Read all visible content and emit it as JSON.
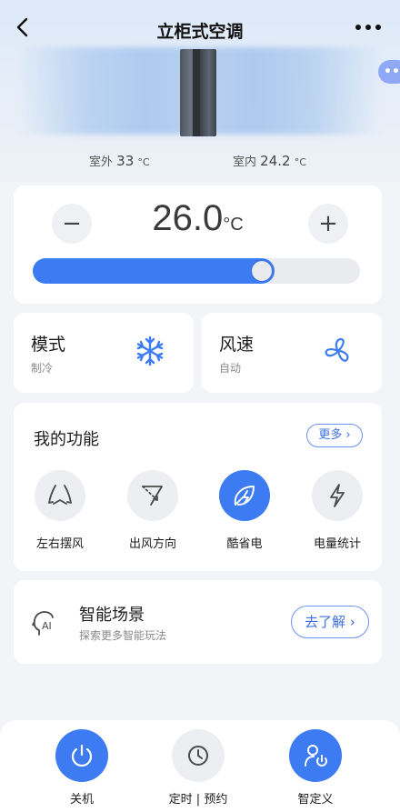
{
  "header": {
    "title": "立柜式空调",
    "back_icon": "chevron-left-icon",
    "more_icon": "more-dots-icon",
    "side_bubble_text": "••"
  },
  "ambient": {
    "outdoor_label": "室外",
    "outdoor_value": "33",
    "outdoor_unit": "°C",
    "indoor_label": "室内",
    "indoor_value": "24.2",
    "indoor_unit": "°C"
  },
  "temperature": {
    "minus_label": "−",
    "plus_label": "+",
    "value": "26.0",
    "unit": "°C",
    "slider_fraction": 0.74
  },
  "mode": {
    "title": "模式",
    "value": "制冷",
    "icon": "snowflake-icon"
  },
  "wind": {
    "title": "风速",
    "value": "自动",
    "icon": "fan-icon"
  },
  "functions": {
    "title": "我的功能",
    "more_label": "更多 ›",
    "items": [
      {
        "label": "左右摆风",
        "icon": "swing-horizontal-icon",
        "active": false
      },
      {
        "label": "出风方向",
        "icon": "airflow-direction-icon",
        "active": false
      },
      {
        "label": "酷省电",
        "icon": "eco-leaf-icon",
        "active": true
      },
      {
        "label": "电量统计",
        "icon": "lightning-icon",
        "active": false
      }
    ]
  },
  "scene": {
    "title": "智能场景",
    "subtitle": "探索更多智能玩法",
    "button_label": "去了解 ›",
    "icon": "ai-head-icon"
  },
  "bottom": {
    "items": [
      {
        "label": "关机",
        "icon": "power-icon"
      },
      {
        "label": "定时 | 预约",
        "icon": "clock-icon"
      },
      {
        "label": "智定义",
        "icon": "user-power-icon"
      }
    ]
  },
  "colors": {
    "accent": "#3d7bf3",
    "background": "#f2f4f7"
  }
}
